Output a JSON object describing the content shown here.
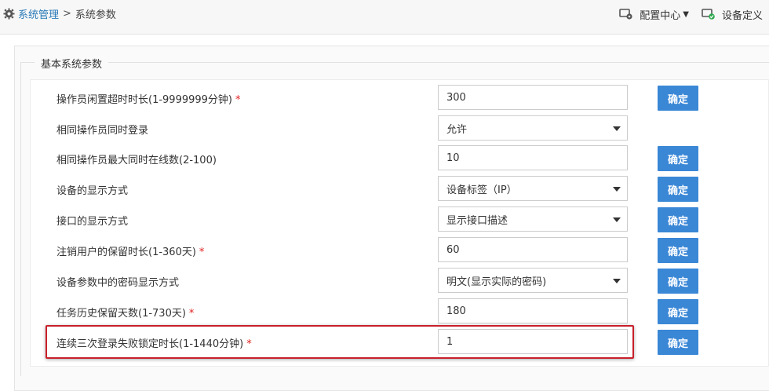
{
  "breadcrumb": {
    "icon": "gear-icon",
    "link": "系统管理",
    "separator": ">",
    "current": "系统参数"
  },
  "toolbar": {
    "config_center": "配置中心",
    "config_center_icon": "config-gear-icon",
    "device_definition": "设备定义",
    "device_definition_icon": "device-define-icon"
  },
  "section": {
    "title": "基本系统参数"
  },
  "colors": {
    "button_bg": "#3a87d6",
    "required": "#e02020",
    "highlight_border": "#c8202a",
    "link": "#2a7ab8"
  },
  "rows": [
    {
      "label": "操作员闲置超时时长(1-9999999分钟)",
      "required": "*",
      "type": "input",
      "value": "300",
      "button": "确定"
    },
    {
      "label": "相同操作员同时登录",
      "required": "",
      "type": "select",
      "value": "允许",
      "button": ""
    },
    {
      "label": "相同操作员最大同时在线数(2-100)",
      "required": "",
      "type": "input",
      "value": "10",
      "button": "确定"
    },
    {
      "label": "设备的显示方式",
      "required": "",
      "type": "select",
      "value": "设备标签（IP）",
      "button": "确定"
    },
    {
      "label": "接口的显示方式",
      "required": "",
      "type": "select",
      "value": "显示接口描述",
      "button": "确定"
    },
    {
      "label": "注销用户的保留时长(1-360天)",
      "required": "*",
      "type": "input",
      "value": "60",
      "button": "确定"
    },
    {
      "label": "设备参数中的密码显示方式",
      "required": "",
      "type": "select",
      "value": "明文(显示实际的密码)",
      "button": "确定"
    },
    {
      "label": "任务历史保留天数(1-730天)",
      "required": "*",
      "type": "input",
      "value": "180",
      "button": "确定"
    },
    {
      "label": "连续三次登录失败锁定时长(1-1440分钟)",
      "required": "*",
      "type": "input",
      "value": "1",
      "button": "确定"
    }
  ]
}
